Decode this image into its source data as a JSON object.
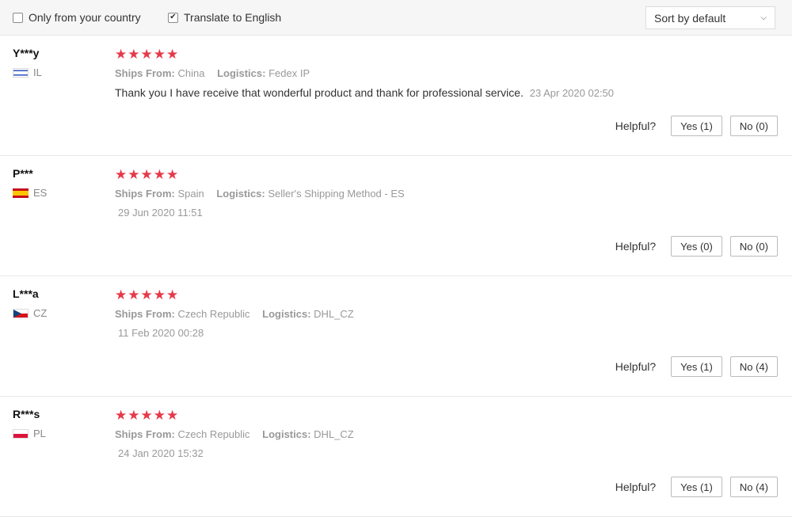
{
  "filters": {
    "country_label": "Only from your country",
    "country_checked": false,
    "translate_label": "Translate to English",
    "translate_checked": true,
    "translate_check_glyph": "✔",
    "sort_selected": "Sort by default",
    "sort_chevron": "⌄"
  },
  "helpful_label": "Helpful?",
  "labels": {
    "ships_from": "Ships From:",
    "logistics": "Logistics:"
  },
  "reviews": [
    {
      "name": "Y***y",
      "country": "IL",
      "flag": "israel-flag-icon",
      "stars": "★★★★★",
      "rating": 5,
      "ships_from": "China",
      "logistics": "Fedex IP",
      "text": "Thank you I have receive that wonderful product and thank for professional service.",
      "date": "23 Apr 2020 02:50",
      "yes": "Yes (1)",
      "no": "No (0)"
    },
    {
      "name": "P***",
      "country": "ES",
      "flag": "spain-flag-icon",
      "stars": "★★★★★",
      "rating": 5,
      "ships_from": "Spain",
      "logistics": "Seller's Shipping Method - ES",
      "date": "29 Jun 2020 11:51",
      "yes": "Yes (0)",
      "no": "No (0)"
    },
    {
      "name": "L***a",
      "country": "CZ",
      "flag": "czech-flag-icon",
      "stars": "★★★★★",
      "rating": 5,
      "ships_from": "Czech Republic",
      "logistics": "DHL_CZ",
      "date": "11 Feb 2020 00:28",
      "yes": "Yes (1)",
      "no": "No (4)"
    },
    {
      "name": "R***s",
      "country": "PL",
      "flag": "poland-flag-icon",
      "stars": "★★★★★",
      "rating": 5,
      "ships_from": "Czech Republic",
      "logistics": "DHL_CZ",
      "date": "24 Jan 2020 15:32",
      "yes": "Yes (1)",
      "no": "No (4)"
    }
  ],
  "colors": {
    "star": "#e6394a",
    "muted": "#999999",
    "bar_bg": "#f6f6f6"
  }
}
